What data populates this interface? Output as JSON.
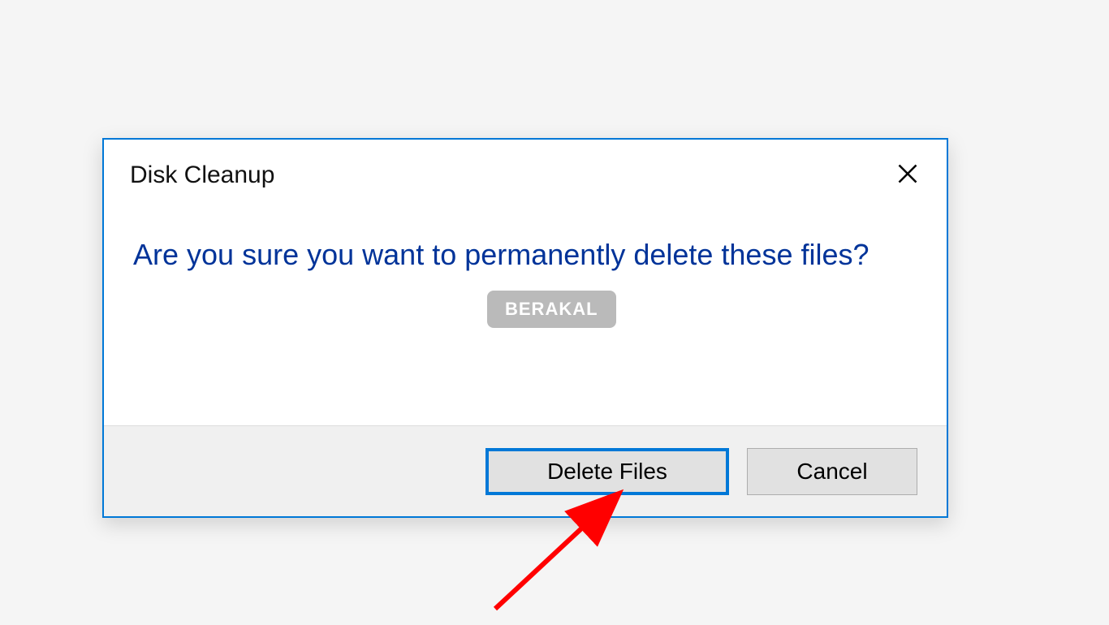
{
  "dialog": {
    "title": "Disk Cleanup",
    "message": "Are you sure you want to permanently delete these files?",
    "buttons": {
      "primary": "Delete Files",
      "secondary": "Cancel"
    }
  },
  "watermark": "BERAKAL"
}
